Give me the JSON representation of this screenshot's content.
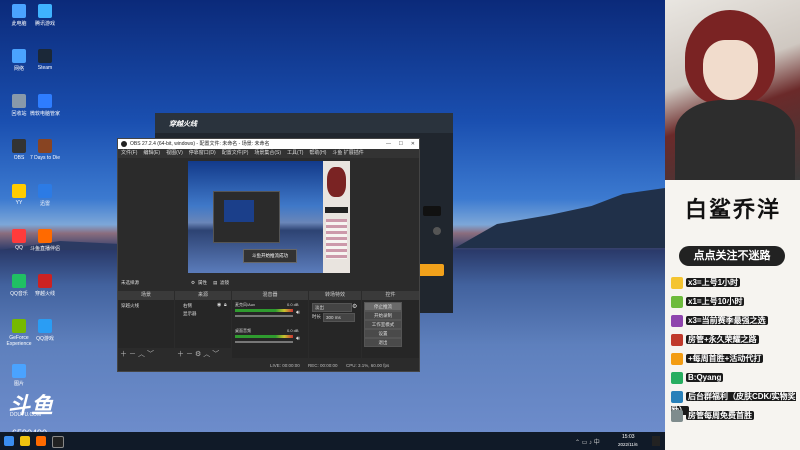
{
  "desktop": {
    "icons": [
      {
        "label": "此电脑",
        "color": "#4aa3ff"
      },
      {
        "label": "腾讯游戏",
        "color": "#3fb3ff"
      },
      {
        "label": "网络",
        "color": "#4aa3ff"
      },
      {
        "label": "Steam",
        "color": "#1b2838"
      },
      {
        "label": "回收站",
        "color": "#8899aa"
      },
      {
        "label": "微软电脑管家",
        "color": "#2e7dff"
      },
      {
        "label": "OBS",
        "color": "#333333"
      },
      {
        "label": "7 Days to Die",
        "color": "#884422"
      },
      {
        "label": "YY",
        "color": "#ffcc00"
      },
      {
        "label": "迅雷",
        "color": "#2c7be5"
      },
      {
        "label": "QQ",
        "color": "#ff3b3b"
      },
      {
        "label": "斗鱼直播伴侣",
        "color": "#ff6a00"
      },
      {
        "label": "QQ音乐",
        "color": "#20c063"
      },
      {
        "label": "穿越火线",
        "color": "#cc2222"
      },
      {
        "label": "GeForce Experience",
        "color": "#76b900"
      },
      {
        "label": "QQ游戏",
        "color": "#2a9df4"
      },
      {
        "label": "图片",
        "color": "#4aa3ff"
      }
    ],
    "logo_text": "斗鱼",
    "logo_sub": "DOUYU.COM",
    "room_id": "6590490"
  },
  "taskbar": {
    "time": "15:03",
    "date": "2022/11/6"
  },
  "obs": {
    "title": "OBS 27.2.4 (64-bit, windows) - 配置文件: 未命名 - 场景: 未命名",
    "menu": [
      "文件(F)",
      "编辑(E)",
      "视图(V)",
      "停靠窗口(D)",
      "配置文件(P)",
      "场景集合(S)",
      "工具(T)",
      "帮助(H)",
      "斗鱼 扩展插件"
    ],
    "preview_toast": "斗鱼开始推流成功",
    "source_bar_label": "未选择源",
    "props_label": "属性",
    "filters_label": "滤镜",
    "docks": {
      "scenes": "场景",
      "sources": "来源",
      "mixer": "混音器",
      "transitions": "转场特效",
      "controls": "控件"
    },
    "scene_item": "穿越火线",
    "sources": [
      "右侧",
      "显示器"
    ],
    "mixer_tracks": [
      {
        "name": "麦克风/Aux",
        "db": "0.0 dB"
      },
      {
        "name": "桌面音频",
        "db": "0.0 dB"
      }
    ],
    "transition_value": "淡出",
    "duration_label": "时长",
    "duration_value": "300 ms",
    "control_buttons": [
      "停止推流",
      "开始录制",
      "工作室模式",
      "设置",
      "退出"
    ],
    "status": {
      "live": "LIVE: 00:00:00",
      "rec": "REC: 00:00:00",
      "cpu": "CPU: 3.1%, 60.00 fps"
    }
  },
  "launcher": {
    "brand": "穿越火线"
  },
  "panel": {
    "title": "白鲨乔洋",
    "badge": "点点关注不迷路",
    "gifts": [
      {
        "text": "x3=上号1小时",
        "color": "#f4c430"
      },
      {
        "text": "x1=上号10小时",
        "color": "#6dbb3c"
      },
      {
        "text": "x3=当前赛季最强之选",
        "color": "#8e44ad"
      },
      {
        "text": "房管+永久荣耀之路",
        "color": "#c0392b"
      },
      {
        "text": "+每周首胜+活动代打",
        "color": "#f39c12"
      },
      {
        "text": "B:Qyang",
        "color": "#27ae60"
      },
      {
        "text": "后台群福利（皮肤CDK/实物奖励）",
        "color": "#2980b9"
      },
      {
        "text": "房管每周免费首胜",
        "color": "#7f8c8d"
      }
    ]
  }
}
